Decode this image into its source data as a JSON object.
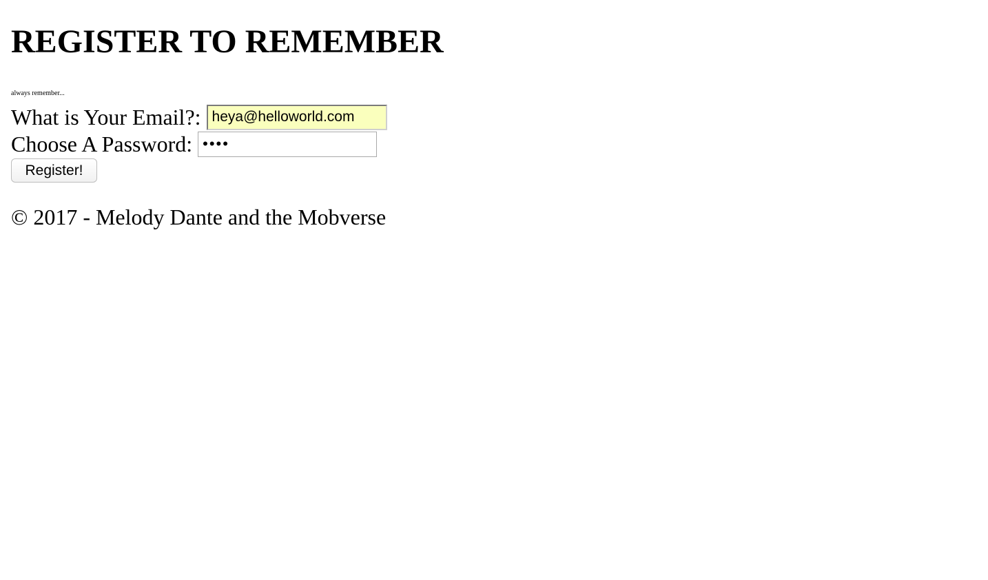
{
  "page": {
    "title": "REGISTER TO REMEMBER",
    "tagline": "always remember..."
  },
  "form": {
    "email_label": "What is Your Email?:",
    "email_value": "heya@helloworld.com",
    "password_label": "Choose A Password:",
    "password_value": "abcd",
    "submit_label": "Register!"
  },
  "footer": {
    "text": "© 2017 - Melody Dante and the Mobverse"
  },
  "colors": {
    "autofill_background": "#faffbd",
    "text": "#000000",
    "background": "#ffffff"
  }
}
